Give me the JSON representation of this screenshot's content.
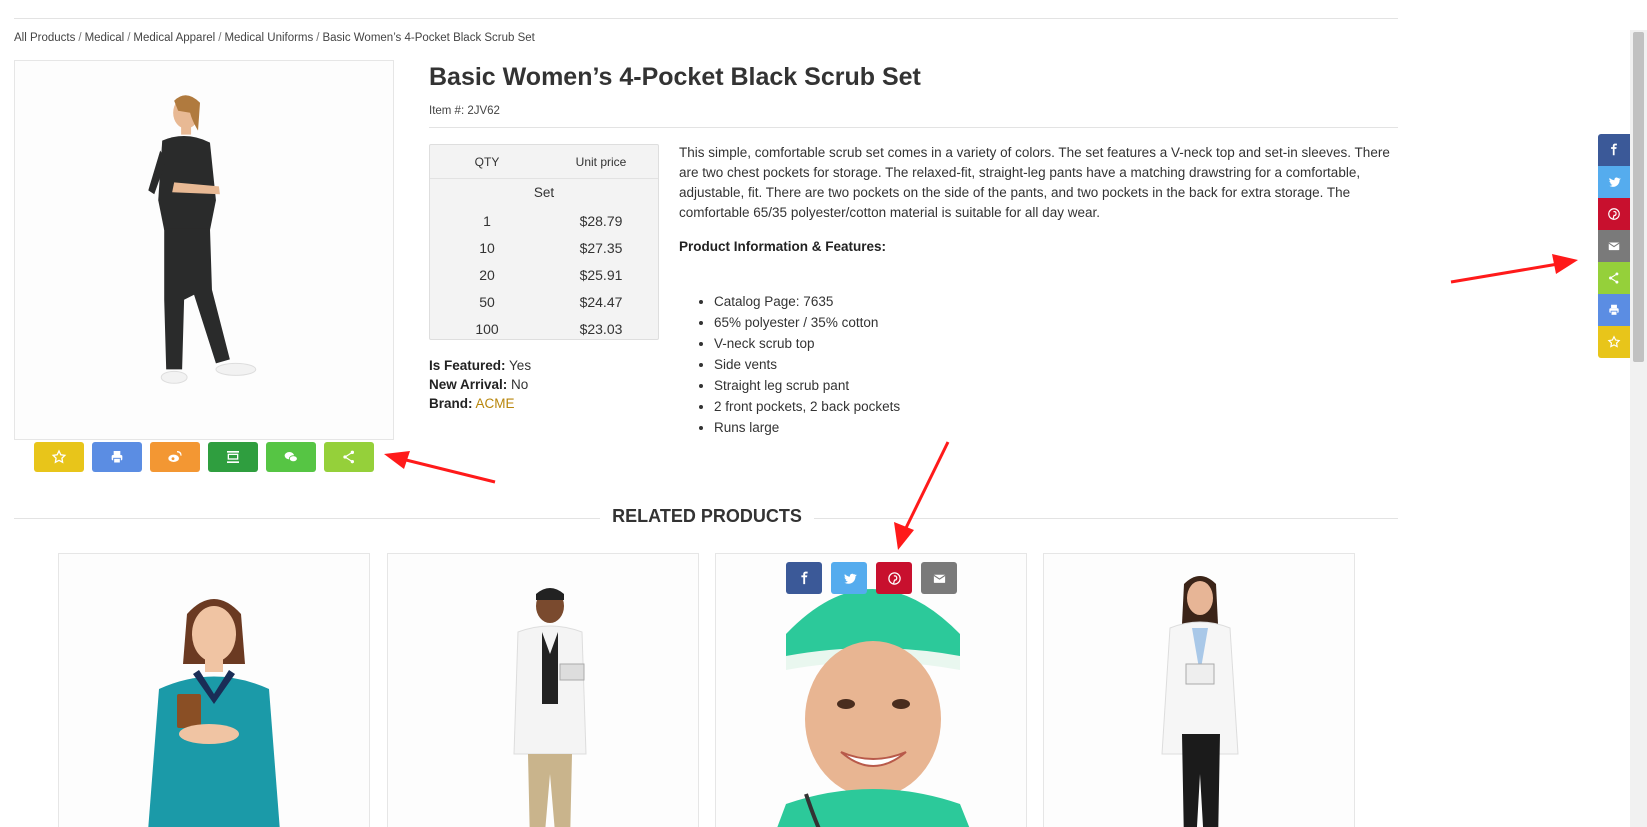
{
  "breadcrumb": {
    "items": [
      "All Products",
      "Medical",
      "Medical Apparel",
      "Medical Uniforms",
      "Basic Women’s 4-Pocket Black Scrub Set"
    ],
    "separator": "/"
  },
  "product": {
    "title": "Basic Women’s 4-Pocket Black Scrub Set",
    "item_number": "Item #: 2JV62",
    "price_table": {
      "headers": [
        "QTY",
        "Unit price"
      ],
      "unit": "Set",
      "rows": [
        {
          "qty": "1",
          "price": "$28.79"
        },
        {
          "qty": "10",
          "price": "$27.35"
        },
        {
          "qty": "20",
          "price": "$25.91"
        },
        {
          "qty": "50",
          "price": "$24.47"
        },
        {
          "qty": "100",
          "price": "$23.03"
        }
      ]
    },
    "attributes": {
      "featured_label": "Is Featured:",
      "featured_value": "Yes",
      "new_label": "New Arrival:",
      "new_value": "No",
      "brand_label": "Brand:",
      "brand_value": "ACME"
    },
    "description": "This simple, comfortable scrub set comes in a variety of colors. The set features a V-neck top and set-in sleeves. There are two chest pockets for storage. The relaxed-fit, straight-leg pants have a matching drawstring for a comfortable, adjustable, fit. There are two pockets on the side of the pants, and two pockets in the back for extra storage. The comfortable 65/35 polyester/cotton material is suitable for all day wear.",
    "features_heading": "Product Information & Features:",
    "features": [
      "Catalog Page: 7635",
      "65% polyester / 35% cotton",
      "V-neck scrub top",
      "Side vents",
      "Straight leg scrub pant",
      "2 front pockets, 2 back pockets",
      "Runs large"
    ]
  },
  "share_buttons": [
    {
      "icon": "star-icon",
      "color": "#e8c51a"
    },
    {
      "icon": "print-icon",
      "color": "#5b8de3"
    },
    {
      "icon": "weibo-icon",
      "color": "#f39733"
    },
    {
      "icon": "douban-icon",
      "color": "#2f9e3f"
    },
    {
      "icon": "wechat-icon",
      "color": "#56c544"
    },
    {
      "icon": "share-icon",
      "color": "#95d03a"
    }
  ],
  "related": {
    "heading": "RELATED PRODUCTS",
    "card_share": [
      {
        "icon": "facebook-icon",
        "color": "#3b5998"
      },
      {
        "icon": "twitter-icon",
        "color": "#55acee"
      },
      {
        "icon": "pinterest-icon",
        "color": "#c8102e"
      },
      {
        "icon": "email-icon",
        "color": "#7a7a7a"
      }
    ]
  },
  "side_share": [
    {
      "icon": "facebook-icon",
      "color": "#3b5998"
    },
    {
      "icon": "twitter-icon",
      "color": "#55acee"
    },
    {
      "icon": "pinterest-icon",
      "color": "#c8102e"
    },
    {
      "icon": "email-icon",
      "color": "#7a7a7a"
    },
    {
      "icon": "share-icon",
      "color": "#95d03a"
    },
    {
      "icon": "print-icon",
      "color": "#5b8de3"
    },
    {
      "icon": "star-icon",
      "color": "#e8c51a"
    }
  ],
  "colors": {
    "annotation_arrow": "#ff1a1a",
    "brand_link": "#b8860b"
  }
}
